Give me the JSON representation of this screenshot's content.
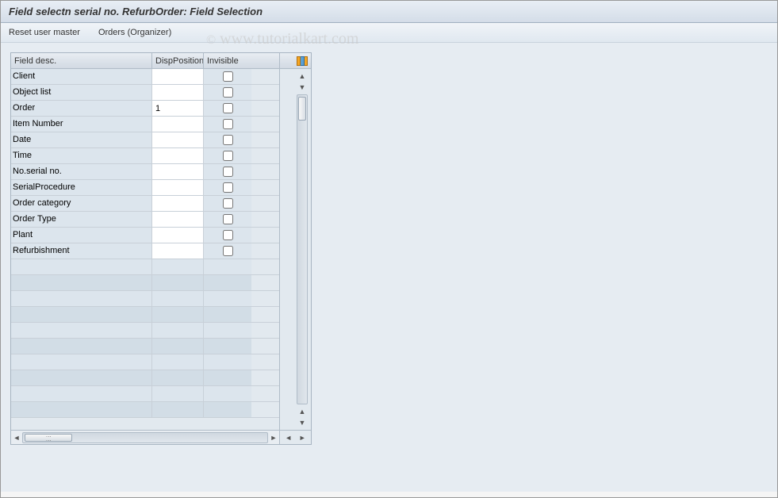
{
  "title": "Field selectn serial no. RefurbOrder: Field Selection",
  "menu": {
    "reset_user_master": "Reset user master",
    "orders_organizer": "Orders (Organizer)"
  },
  "table": {
    "headers": {
      "field_desc": "Field desc.",
      "disp_position": "DispPosition",
      "invisible": "Invisible"
    },
    "rows": [
      {
        "desc": "Client",
        "pos": "",
        "invisible": false
      },
      {
        "desc": "Object list",
        "pos": "",
        "invisible": false
      },
      {
        "desc": "Order",
        "pos": "1",
        "invisible": false
      },
      {
        "desc": "Item Number",
        "pos": "",
        "invisible": false
      },
      {
        "desc": "Date",
        "pos": "",
        "invisible": false
      },
      {
        "desc": "Time",
        "pos": "",
        "invisible": false
      },
      {
        "desc": "No.serial no.",
        "pos": "",
        "invisible": false
      },
      {
        "desc": "SerialProcedure",
        "pos": "",
        "invisible": false
      },
      {
        "desc": "Order category",
        "pos": "",
        "invisible": false
      },
      {
        "desc": "Order Type",
        "pos": "",
        "invisible": false
      },
      {
        "desc": "Plant",
        "pos": "",
        "invisible": false
      },
      {
        "desc": "Refurbishment",
        "pos": "",
        "invisible": false
      }
    ],
    "empty_rows_count": 10
  },
  "watermark": "www.tutorialkart.com"
}
